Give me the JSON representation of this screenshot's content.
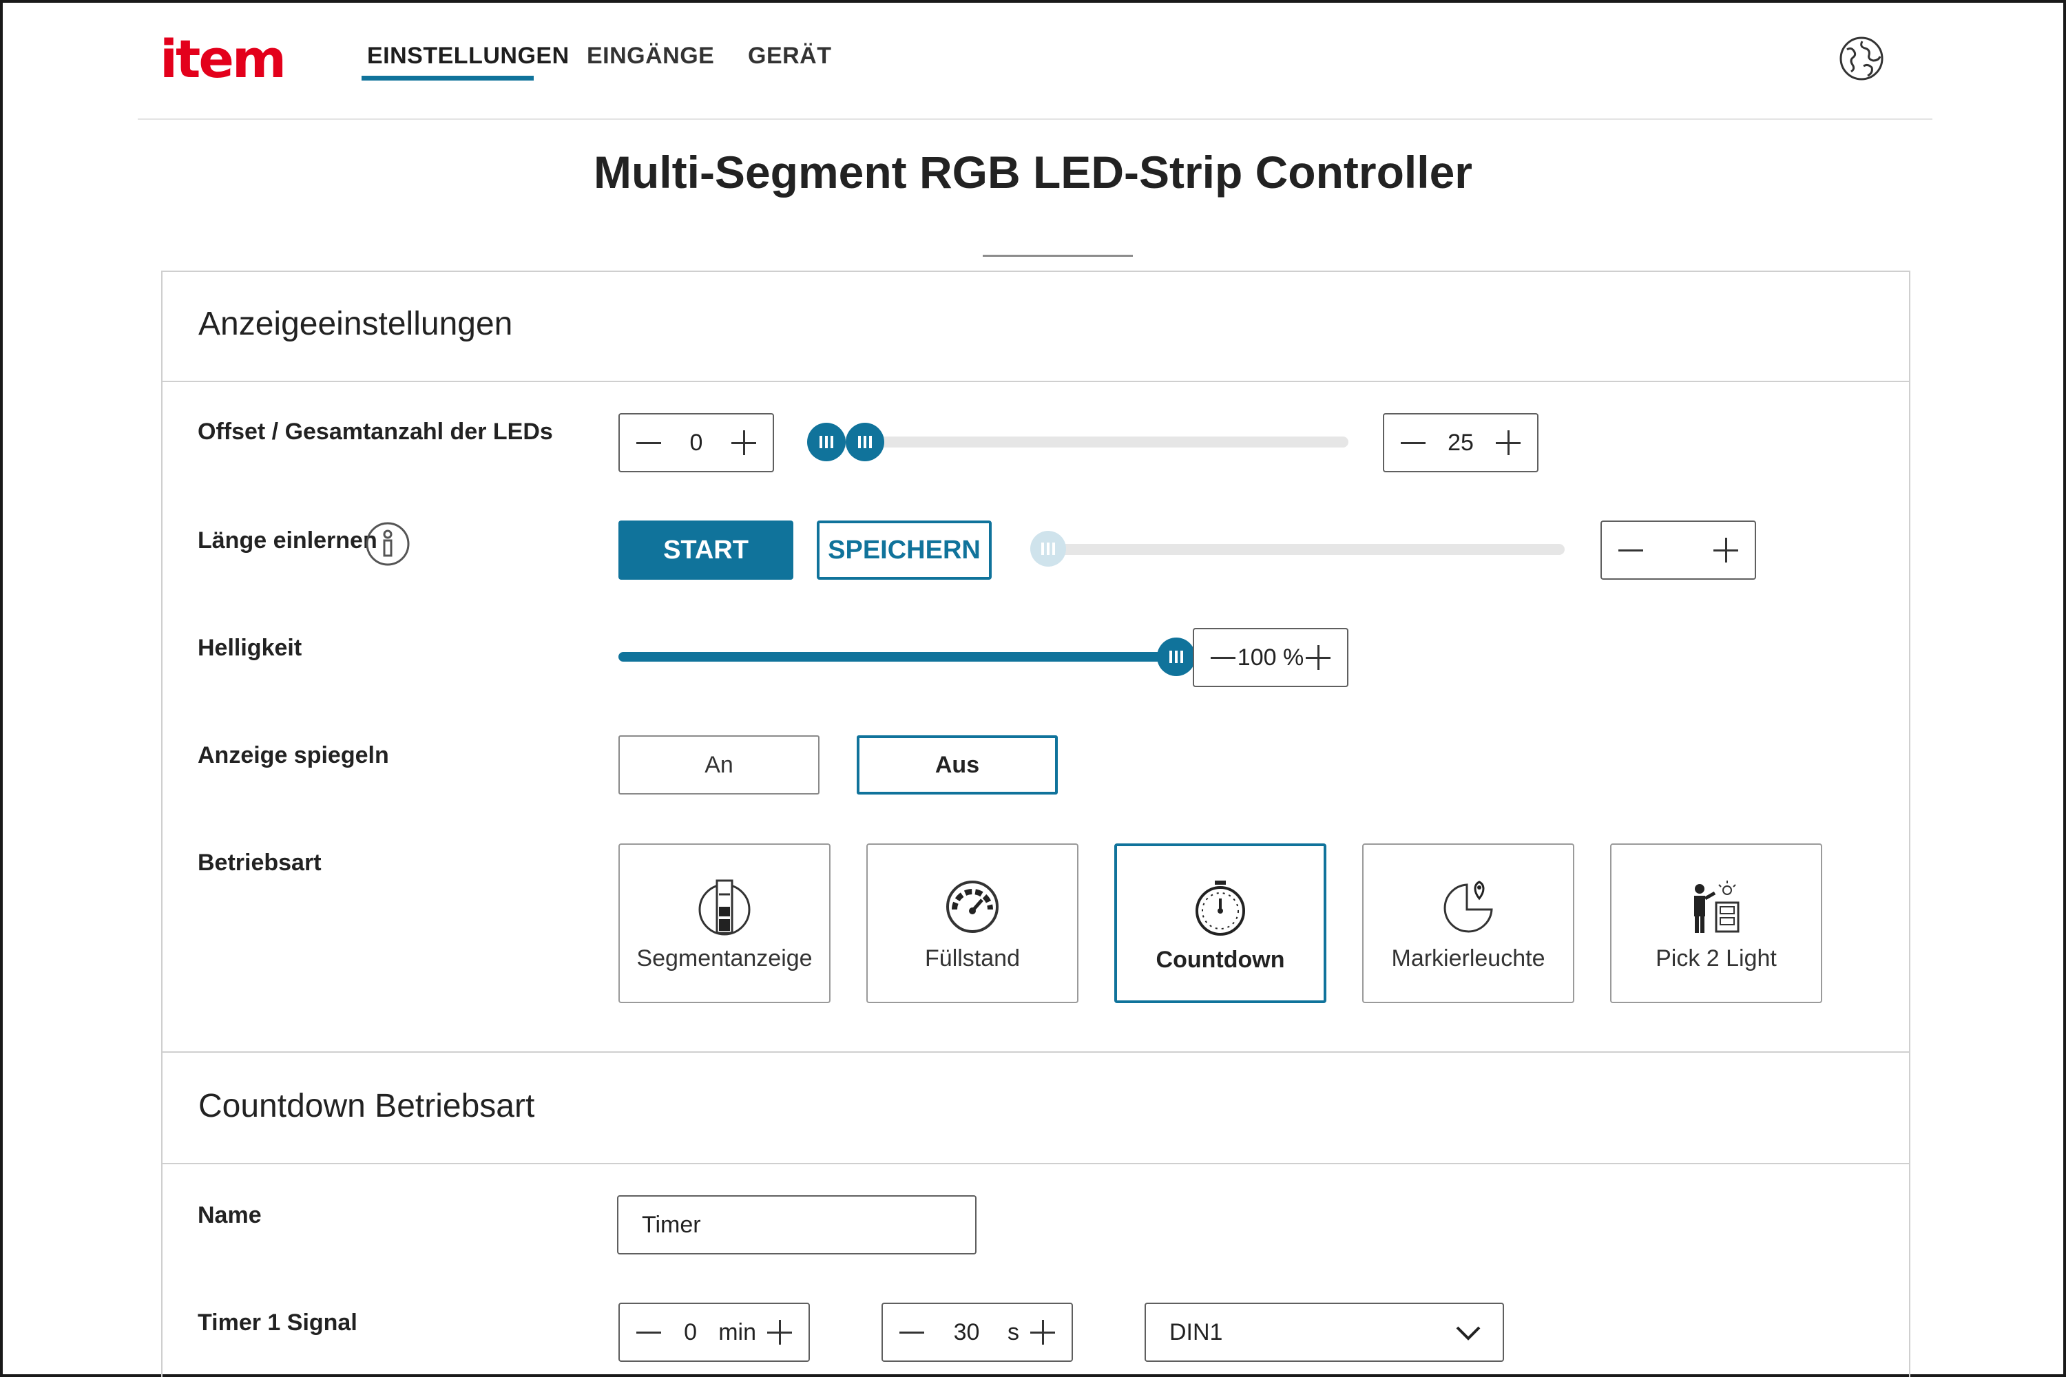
{
  "header": {
    "logo": "item",
    "nav": [
      {
        "label": "EINSTELLUNGEN",
        "active": true
      },
      {
        "label": "EINGÄNGE",
        "active": false
      },
      {
        "label": "GERÄT",
        "active": false
      }
    ],
    "language_icon": "globe-icon"
  },
  "page_title": "Multi-Segment RGB LED-Strip Controller",
  "display_settings": {
    "title": "Anzeigeeinstellungen",
    "offset_total": {
      "label": "Offset / Gesamtanzahl der LEDs",
      "offset_value": "0",
      "total_value": "25"
    },
    "learn_length": {
      "label": "Länge einlernen",
      "start_label": "START",
      "save_label": "SPEICHERN",
      "value": ""
    },
    "brightness": {
      "label": "Helligkeit",
      "value": "100",
      "unit": "%",
      "level": 1.0
    },
    "mirror": {
      "label": "Anzeige spiegeln",
      "on_label": "An",
      "off_label": "Aus",
      "selected": "Aus"
    },
    "mode": {
      "label": "Betriebsart",
      "options": [
        {
          "label": "Segmentanzeige",
          "icon": "segment-bar-icon"
        },
        {
          "label": "Füllstand",
          "icon": "gauge-icon"
        },
        {
          "label": "Countdown",
          "icon": "stopwatch-icon"
        },
        {
          "label": "Markierleuchte",
          "icon": "pie-marker-icon"
        },
        {
          "label": "Pick 2 Light",
          "icon": "pick-to-light-icon"
        }
      ],
      "selected": "Countdown"
    }
  },
  "countdown": {
    "title": "Countdown Betriebsart",
    "name": {
      "label": "Name",
      "value": "Timer"
    },
    "timer1": {
      "label": "Timer 1 Signal",
      "minutes": "0",
      "minutes_unit": "min",
      "seconds": "30",
      "seconds_unit": "s",
      "input": "DIN1"
    }
  },
  "colors": {
    "accent": "#10739b",
    "brand": "#e3001b"
  }
}
